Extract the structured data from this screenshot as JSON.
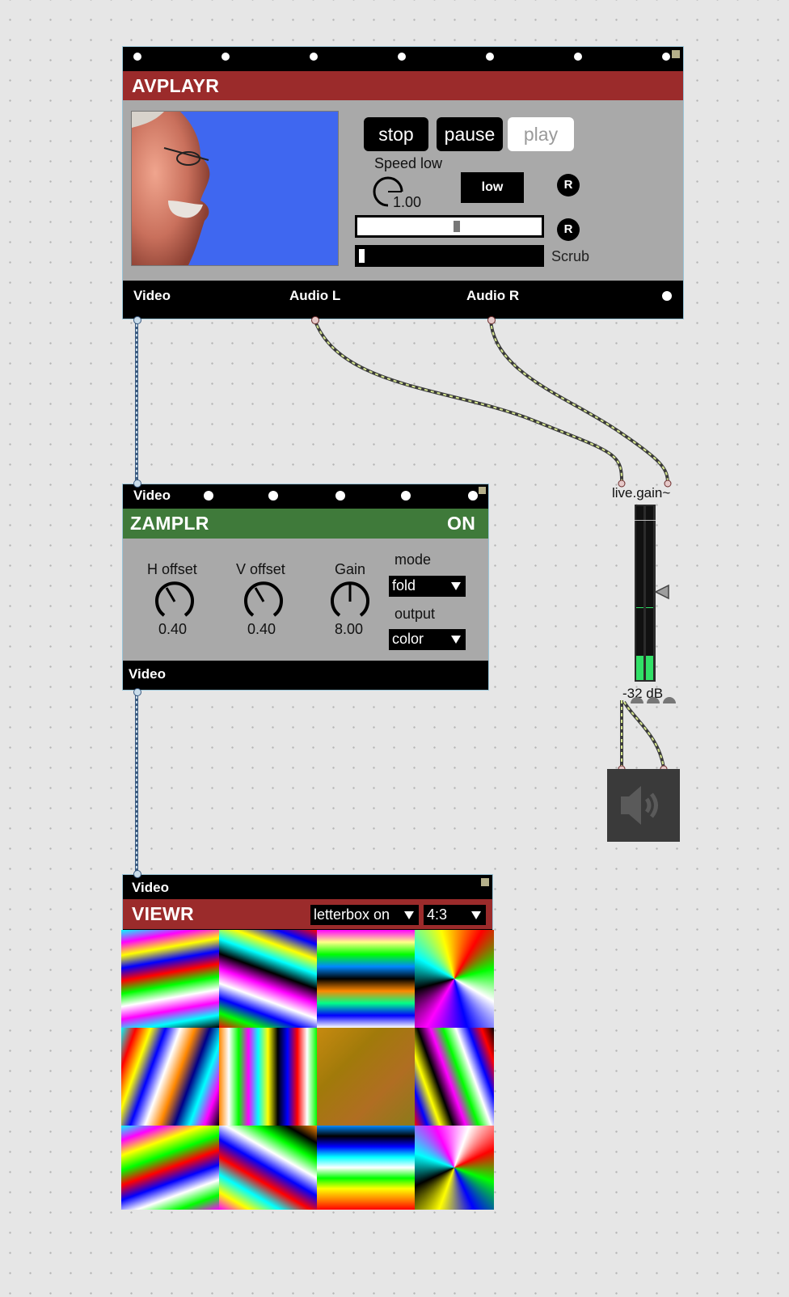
{
  "avplayr": {
    "title": "AVPLAYR",
    "buttons": {
      "stop": "stop",
      "pause": "pause",
      "play": "play"
    },
    "speed_label": "Speed low",
    "speed_value": "1.00",
    "low_button": "low",
    "reset_label": "R",
    "scrub_label": "Scrub",
    "outputs": {
      "video": "Video",
      "audio_l": "Audio L",
      "audio_r": "Audio R"
    }
  },
  "zamplr": {
    "input_label": "Video",
    "title": "ZAMPLR",
    "status": "ON",
    "knobs": [
      {
        "label": "H offset",
        "value": "0.40"
      },
      {
        "label": "V offset",
        "value": "0.40"
      },
      {
        "label": "Gain",
        "value": "8.00"
      }
    ],
    "mode_label": "mode",
    "mode_value": "fold",
    "output_label": "output",
    "output_value": "color",
    "output_jack": "Video"
  },
  "live_gain": {
    "label": "live.gain~",
    "db_readout": "-32 dB"
  },
  "viewr": {
    "input_label": "Video",
    "title": "VIEWR",
    "letterbox_value": "letterbox on",
    "aspect_value": "4:3"
  },
  "colors": {
    "avplayr_header": "#9b2b2b",
    "zamplr_header": "#3f7a3a",
    "viewr_header": "#9b2b2b",
    "patch_cord_audio": "#c8d98a",
    "patch_cord_video": "#6a8fb5",
    "meter_green": "#31e067"
  },
  "icons": {
    "speaker": "speaker-volume-icon"
  }
}
